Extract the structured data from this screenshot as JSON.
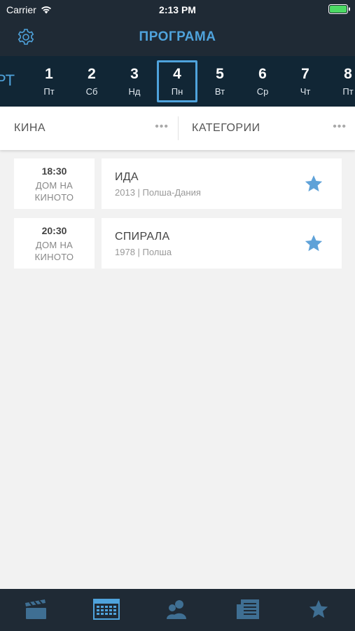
{
  "status": {
    "carrier": "Carrier",
    "time": "2:13 PM"
  },
  "header": {
    "title": "ПРОГРАМА"
  },
  "month_label": "РТ",
  "days": [
    {
      "num": "1",
      "wd": "Пт"
    },
    {
      "num": "2",
      "wd": "Сб"
    },
    {
      "num": "3",
      "wd": "Нд"
    },
    {
      "num": "4",
      "wd": "Пн"
    },
    {
      "num": "5",
      "wd": "Вт"
    },
    {
      "num": "6",
      "wd": "Ср"
    },
    {
      "num": "7",
      "wd": "Чт"
    },
    {
      "num": "8",
      "wd": "Пт"
    }
  ],
  "selected_day": "4",
  "filters": {
    "cinemas_label": "КИНА",
    "categories_label": "КАТЕГОРИИ",
    "more": "•••"
  },
  "screenings": [
    {
      "time": "18:30",
      "venue_line1": "ДОМ НА",
      "venue_line2": "КИНОТО",
      "title": "ИДА",
      "meta": "2013 | Полша-Дания"
    },
    {
      "time": "20:30",
      "venue_line1": "ДОМ НА",
      "venue_line2": "КИНОТО",
      "title": "СПИРАЛА",
      "meta": "1978 | Полша"
    }
  ],
  "tabs": [
    {
      "icon": "clapperboard-icon"
    },
    {
      "icon": "calendar-icon",
      "active": true
    },
    {
      "icon": "people-icon"
    },
    {
      "icon": "news-icon"
    },
    {
      "icon": "star-icon"
    }
  ],
  "colors": {
    "accent": "#4fa3dc",
    "header_bg": "#1f2a35",
    "date_bg": "#112635",
    "tab_inactive": "#3f6f93"
  }
}
